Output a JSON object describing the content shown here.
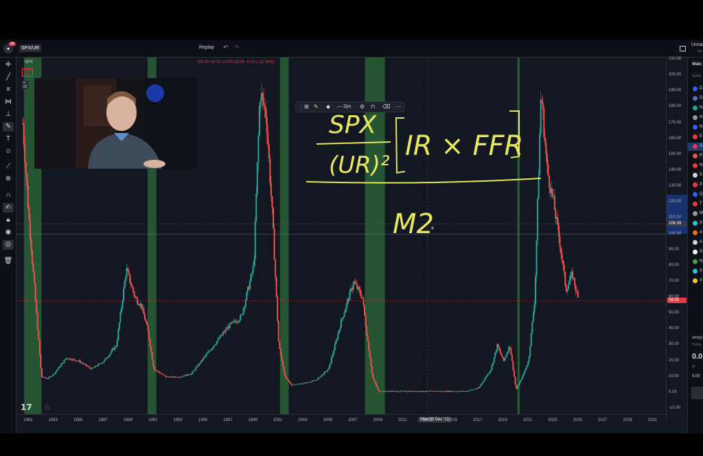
{
  "toolbar": {
    "notification_count": "15",
    "symbol": "SPX/UR",
    "replay_label": "Replay",
    "layout_name": "Unna",
    "layout_sub": "Sa"
  },
  "legend": {
    "symbol": "SPX",
    "ohlc": "O0.00 H0.00 L0.00 C0.00 -0.00 (-12.34%)",
    "sell_price": "0.00",
    "sell_label": "SELL",
    "interval": "22"
  },
  "float_toolbar": {
    "width_label": "2px"
  },
  "price_axis": {
    "ticks": [
      "210.00",
      "200.00",
      "190.00",
      "180.00",
      "170.00",
      "160.00",
      "150.00",
      "140.00",
      "130.00",
      "120.00",
      "110.00",
      "100.00",
      "90.00",
      "80.00",
      "70.00",
      "60.00",
      "50.00",
      "40.00",
      "30.00",
      "20.00",
      "10.00",
      "0.00",
      "-10.00"
    ],
    "crosshair_price": "106.39",
    "last_price": "58.06"
  },
  "time_axis": {
    "ticks": [
      "1981",
      "1983",
      "1985",
      "1987",
      "1989",
      "1991",
      "1993",
      "1995",
      "1997",
      "1999",
      "2001",
      "2003",
      "2005",
      "2007",
      "2009",
      "2011",
      "2013",
      "2015",
      "2017",
      "2019",
      "2021",
      "2023",
      "2025",
      "2027",
      "2029",
      "2031"
    ],
    "crosshair_label": "Mon 03 Dec '12"
  },
  "annotation": {
    "numerator": "SPX",
    "denominator": "(UR)²",
    "bracket_text": "IR × FFR",
    "divisor": "M2"
  },
  "chart_data": {
    "type": "bar",
    "title": "",
    "xlabel": "",
    "ylabel": "",
    "ylim": [
      -10,
      210
    ],
    "x": [
      1980.5,
      1981,
      1981.5,
      1982,
      1982.5,
      1983,
      1984,
      1985,
      1986,
      1987,
      1988,
      1988.8,
      1989.5,
      1990,
      1990.5,
      1991,
      1992,
      1993,
      1994,
      1995,
      1996,
      1997,
      1998,
      1999,
      1999.5,
      2000,
      2000.5,
      2001,
      2001.5,
      2002,
      2003,
      2004,
      2005,
      2006,
      2007,
      2007.7,
      2008,
      2008.5,
      2009,
      2010,
      2012,
      2014,
      2016,
      2017,
      2018,
      2018.5,
      2019,
      2019.5,
      2020,
      2020.5,
      2021,
      2021.5,
      2022,
      2022.5,
      2023,
      2023.5,
      2024,
      2024.5,
      2025
    ],
    "values": [
      170,
      110,
      60,
      10,
      9,
      12,
      22,
      20,
      15,
      20,
      30,
      78,
      60,
      55,
      40,
      15,
      10,
      10,
      12,
      22,
      32,
      42,
      48,
      80,
      190,
      175,
      110,
      30,
      10,
      5,
      6,
      8,
      15,
      45,
      70,
      60,
      40,
      10,
      1,
      1,
      1,
      1,
      1,
      3,
      15,
      30,
      20,
      30,
      2,
      10,
      20,
      60,
      190,
      140,
      120,
      95,
      65,
      75,
      58
    ]
  },
  "recession_bands": [
    [
      1980.6,
      1982.0
    ],
    [
      1990.5,
      1991.2
    ],
    [
      2001.1,
      2001.8
    ],
    [
      2007.9,
      2009.5
    ],
    [
      2020.1,
      2020.3
    ]
  ],
  "colors": {
    "up": "#26a69a",
    "down": "#ef5350",
    "recession": "#2e6b3a",
    "annotation": "#e8e85a",
    "background": "#131722"
  },
  "left_tools": [
    "crosshair-icon",
    "trendline-icon",
    "fib-icon",
    "pattern-icon",
    "measure-tool-icon",
    "brush-icon",
    "text-icon",
    "emoji-icon",
    "ruler-icon",
    "zoom-icon",
    "magnet-icon",
    "stay-drawing-icon",
    "lock-icon",
    "eye-icon",
    "globe-icon",
    "trash-icon"
  ],
  "watchlist": {
    "title": "Watc",
    "column": "Symb",
    "rows": [
      {
        "letter": "D",
        "color": "#2962ff"
      },
      {
        "letter": "D",
        "color": "#5c6bc0"
      },
      {
        "letter": "N",
        "color": "#26a69a"
      },
      {
        "letter": "N",
        "color": "#9598a1"
      },
      {
        "letter": "N",
        "color": "#2962ff"
      },
      {
        "letter": "E",
        "color": "#f23645"
      },
      {
        "letter": "S",
        "color": "#f23645"
      },
      {
        "letter": "R",
        "color": "#ef5350"
      },
      {
        "letter": "N",
        "color": "#f23645"
      },
      {
        "letter": "S",
        "color": "#d1d4dc"
      },
      {
        "letter": "X",
        "color": "#f23645"
      },
      {
        "letter": "Q",
        "color": "#2962ff"
      },
      {
        "letter": "T",
        "color": "#f23645"
      },
      {
        "letter": "M",
        "color": "#9598a1"
      },
      {
        "letter": "X",
        "color": "#26c6da"
      },
      {
        "letter": "A",
        "color": "#ff6d00"
      },
      {
        "letter": "A",
        "color": "#d1d4dc"
      },
      {
        "letter": "G",
        "color": "#ffffff"
      },
      {
        "letter": "N",
        "color": "#43a047"
      },
      {
        "letter": "X",
        "color": "#26c6da"
      },
      {
        "letter": "X",
        "color": "#fbc02d"
      }
    ],
    "detail_symbol": "SPX/U",
    "detail_sub": "Comp",
    "detail_price": "0.0",
    "detail_market": "M",
    "detail_value": "0.00"
  }
}
